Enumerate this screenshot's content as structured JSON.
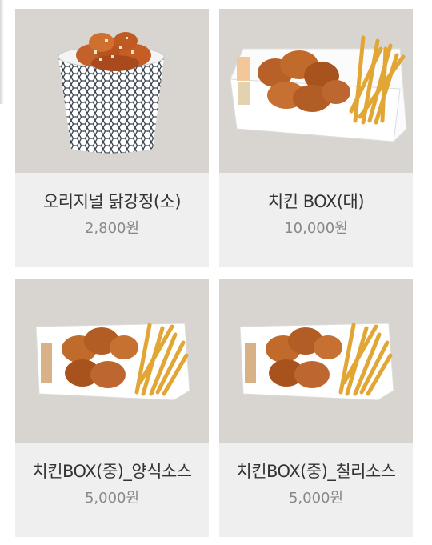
{
  "products": [
    {
      "name": "오리지널 닭강정(소)",
      "price": "2,800원",
      "image_icon": "chicken-cup-icon"
    },
    {
      "name": "치킨 BOX(대)",
      "price": "10,000원",
      "image_icon": "chicken-box-large-icon"
    },
    {
      "name": "치킨BOX(중)_양식소스",
      "price": "5,000원",
      "image_icon": "chicken-box-medium-icon"
    },
    {
      "name": "치킨BOX(중)_칠리소스",
      "price": "5,000원",
      "image_icon": "chicken-box-medium-icon"
    }
  ],
  "colors": {
    "card_bg": "#f0eff0",
    "image_bg": "#d8d5d0",
    "name_text": "#333333",
    "price_text": "#888888",
    "chicken": "#b85a24",
    "fries": "#e0a030"
  }
}
